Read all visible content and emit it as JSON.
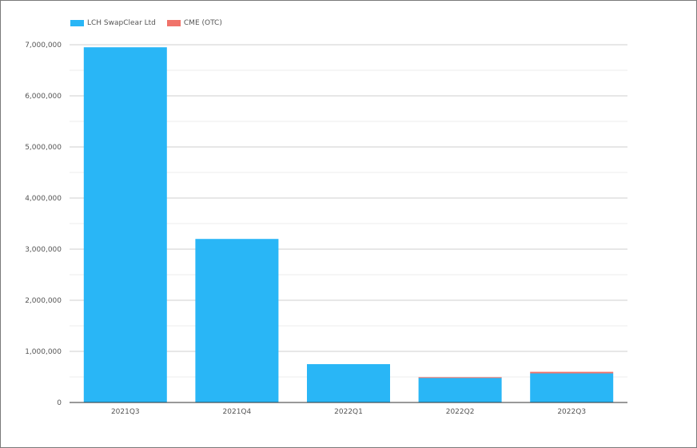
{
  "chart_data": {
    "type": "bar",
    "stacked": true,
    "categories": [
      "2021Q3",
      "2021Q4",
      "2022Q1",
      "2022Q2",
      "2022Q3"
    ],
    "series": [
      {
        "name": "LCH SwapClear Ltd",
        "color": "#29b6f6",
        "values": [
          6950000,
          3200000,
          750000,
          490000,
          570000
        ]
      },
      {
        "name": "CME (OTC)",
        "color": "#f0736a",
        "values": [
          0,
          0,
          0,
          5000,
          30000
        ]
      }
    ],
    "ylim": [
      0,
      7000000
    ],
    "y_ticks": [
      "0",
      "1,000,000",
      "2,000,000",
      "3,000,000",
      "4,000,000",
      "5,000,000",
      "6,000,000",
      "7,000,000"
    ],
    "grid": true,
    "legend_position": "top-left",
    "title": "",
    "xlabel": "",
    "ylabel": ""
  }
}
